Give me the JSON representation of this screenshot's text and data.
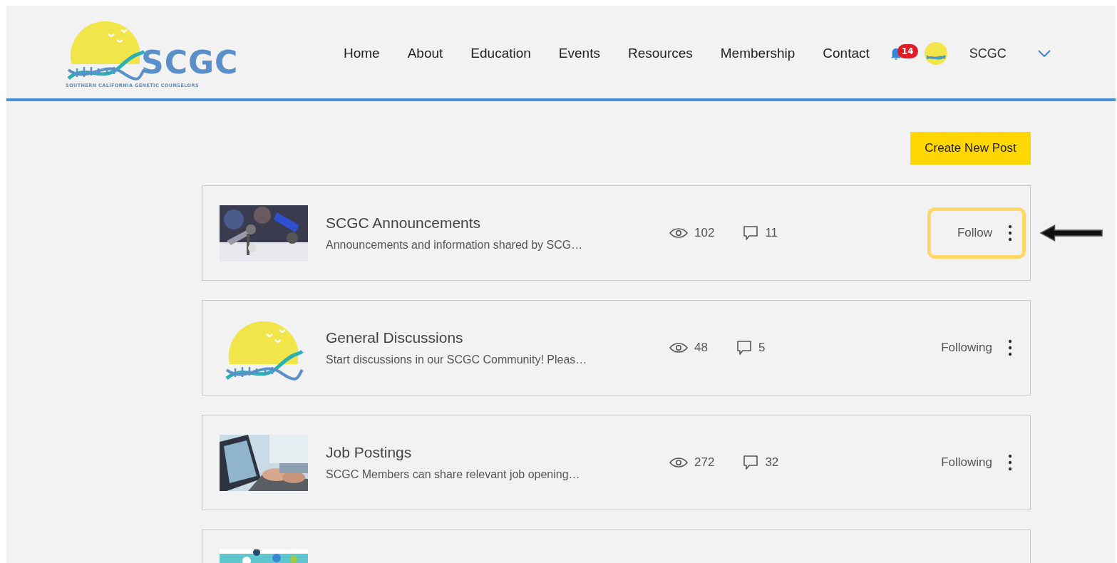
{
  "logo": {
    "name": "SCGC",
    "tagline": "SOUTHERN CALIFORNIA GENETIC COUNSELORS"
  },
  "nav": [
    {
      "label": "Home"
    },
    {
      "label": "About"
    },
    {
      "label": "Education"
    },
    {
      "label": "Events"
    },
    {
      "label": "Resources"
    },
    {
      "label": "Membership"
    },
    {
      "label": "Contact"
    }
  ],
  "notifications": {
    "count": "14"
  },
  "user": {
    "name": "SCGC"
  },
  "create_button": "Create New Post",
  "categories": [
    {
      "title": "SCGC Announcements",
      "description": "Announcements and information shared by SCG…",
      "views": "102",
      "comments": "11",
      "follow": "Follow",
      "highlighted": true
    },
    {
      "thumbnail": {
        "kind": "logo"
      },
      "title": "General Discussions",
      "description": "Start discussions in our SCGC Community! Pleas…",
      "views": "48",
      "comments": "5",
      "follow": "Following",
      "highlighted": false
    },
    {
      "title": "Job Postings",
      "description": "SCGC Members can share relevant job opening…",
      "views": "272",
      "comments": "32",
      "follow": "Following",
      "highlighted": false
    },
    {
      "thumbnail": {
        "kind": "banner"
      }
    }
  ]
}
